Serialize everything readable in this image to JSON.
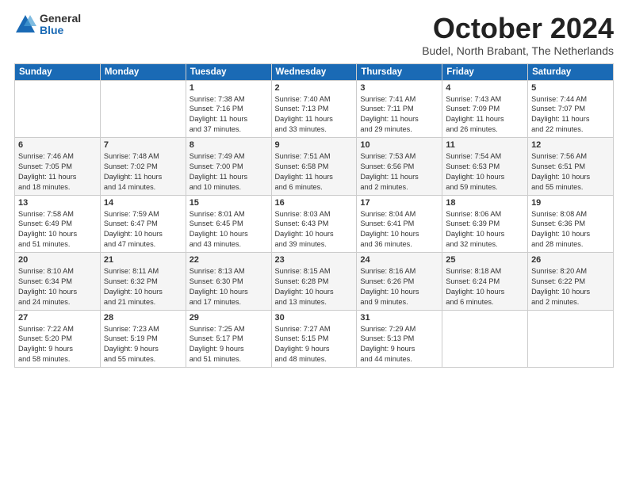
{
  "logo": {
    "general": "General",
    "blue": "Blue"
  },
  "title": "October 2024",
  "subtitle": "Budel, North Brabant, The Netherlands",
  "headers": [
    "Sunday",
    "Monday",
    "Tuesday",
    "Wednesday",
    "Thursday",
    "Friday",
    "Saturday"
  ],
  "weeks": [
    [
      {
        "num": "",
        "detail": ""
      },
      {
        "num": "",
        "detail": ""
      },
      {
        "num": "1",
        "detail": "Sunrise: 7:38 AM\nSunset: 7:16 PM\nDaylight: 11 hours\nand 37 minutes."
      },
      {
        "num": "2",
        "detail": "Sunrise: 7:40 AM\nSunset: 7:13 PM\nDaylight: 11 hours\nand 33 minutes."
      },
      {
        "num": "3",
        "detail": "Sunrise: 7:41 AM\nSunset: 7:11 PM\nDaylight: 11 hours\nand 29 minutes."
      },
      {
        "num": "4",
        "detail": "Sunrise: 7:43 AM\nSunset: 7:09 PM\nDaylight: 11 hours\nand 26 minutes."
      },
      {
        "num": "5",
        "detail": "Sunrise: 7:44 AM\nSunset: 7:07 PM\nDaylight: 11 hours\nand 22 minutes."
      }
    ],
    [
      {
        "num": "6",
        "detail": "Sunrise: 7:46 AM\nSunset: 7:05 PM\nDaylight: 11 hours\nand 18 minutes."
      },
      {
        "num": "7",
        "detail": "Sunrise: 7:48 AM\nSunset: 7:02 PM\nDaylight: 11 hours\nand 14 minutes."
      },
      {
        "num": "8",
        "detail": "Sunrise: 7:49 AM\nSunset: 7:00 PM\nDaylight: 11 hours\nand 10 minutes."
      },
      {
        "num": "9",
        "detail": "Sunrise: 7:51 AM\nSunset: 6:58 PM\nDaylight: 11 hours\nand 6 minutes."
      },
      {
        "num": "10",
        "detail": "Sunrise: 7:53 AM\nSunset: 6:56 PM\nDaylight: 11 hours\nand 2 minutes."
      },
      {
        "num": "11",
        "detail": "Sunrise: 7:54 AM\nSunset: 6:53 PM\nDaylight: 10 hours\nand 59 minutes."
      },
      {
        "num": "12",
        "detail": "Sunrise: 7:56 AM\nSunset: 6:51 PM\nDaylight: 10 hours\nand 55 minutes."
      }
    ],
    [
      {
        "num": "13",
        "detail": "Sunrise: 7:58 AM\nSunset: 6:49 PM\nDaylight: 10 hours\nand 51 minutes."
      },
      {
        "num": "14",
        "detail": "Sunrise: 7:59 AM\nSunset: 6:47 PM\nDaylight: 10 hours\nand 47 minutes."
      },
      {
        "num": "15",
        "detail": "Sunrise: 8:01 AM\nSunset: 6:45 PM\nDaylight: 10 hours\nand 43 minutes."
      },
      {
        "num": "16",
        "detail": "Sunrise: 8:03 AM\nSunset: 6:43 PM\nDaylight: 10 hours\nand 39 minutes."
      },
      {
        "num": "17",
        "detail": "Sunrise: 8:04 AM\nSunset: 6:41 PM\nDaylight: 10 hours\nand 36 minutes."
      },
      {
        "num": "18",
        "detail": "Sunrise: 8:06 AM\nSunset: 6:39 PM\nDaylight: 10 hours\nand 32 minutes."
      },
      {
        "num": "19",
        "detail": "Sunrise: 8:08 AM\nSunset: 6:36 PM\nDaylight: 10 hours\nand 28 minutes."
      }
    ],
    [
      {
        "num": "20",
        "detail": "Sunrise: 8:10 AM\nSunset: 6:34 PM\nDaylight: 10 hours\nand 24 minutes."
      },
      {
        "num": "21",
        "detail": "Sunrise: 8:11 AM\nSunset: 6:32 PM\nDaylight: 10 hours\nand 21 minutes."
      },
      {
        "num": "22",
        "detail": "Sunrise: 8:13 AM\nSunset: 6:30 PM\nDaylight: 10 hours\nand 17 minutes."
      },
      {
        "num": "23",
        "detail": "Sunrise: 8:15 AM\nSunset: 6:28 PM\nDaylight: 10 hours\nand 13 minutes."
      },
      {
        "num": "24",
        "detail": "Sunrise: 8:16 AM\nSunset: 6:26 PM\nDaylight: 10 hours\nand 9 minutes."
      },
      {
        "num": "25",
        "detail": "Sunrise: 8:18 AM\nSunset: 6:24 PM\nDaylight: 10 hours\nand 6 minutes."
      },
      {
        "num": "26",
        "detail": "Sunrise: 8:20 AM\nSunset: 6:22 PM\nDaylight: 10 hours\nand 2 minutes."
      }
    ],
    [
      {
        "num": "27",
        "detail": "Sunrise: 7:22 AM\nSunset: 5:20 PM\nDaylight: 9 hours\nand 58 minutes."
      },
      {
        "num": "28",
        "detail": "Sunrise: 7:23 AM\nSunset: 5:19 PM\nDaylight: 9 hours\nand 55 minutes."
      },
      {
        "num": "29",
        "detail": "Sunrise: 7:25 AM\nSunset: 5:17 PM\nDaylight: 9 hours\nand 51 minutes."
      },
      {
        "num": "30",
        "detail": "Sunrise: 7:27 AM\nSunset: 5:15 PM\nDaylight: 9 hours\nand 48 minutes."
      },
      {
        "num": "31",
        "detail": "Sunrise: 7:29 AM\nSunset: 5:13 PM\nDaylight: 9 hours\nand 44 minutes."
      },
      {
        "num": "",
        "detail": ""
      },
      {
        "num": "",
        "detail": ""
      }
    ]
  ]
}
